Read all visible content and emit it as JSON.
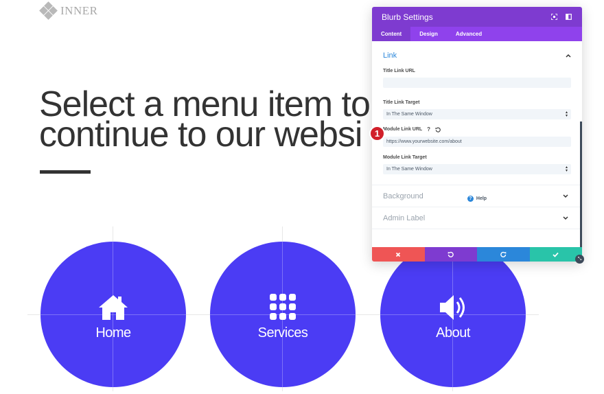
{
  "page": {
    "logo_text": "INNER",
    "hero_line_1": "Select a menu item to",
    "hero_line_2": "continue to our websi",
    "blurbs": [
      {
        "label": "Home",
        "icon": "home-icon"
      },
      {
        "label": "Services",
        "icon": "grid-icon"
      },
      {
        "label": "About",
        "icon": "speaker-icon"
      }
    ]
  },
  "panel": {
    "title": "Blurb Settings",
    "tabs": [
      "Content",
      "Design",
      "Advanced"
    ],
    "active_tab": "Content",
    "link_section": {
      "title": "Link",
      "title_link_url_label": "Title Link URL",
      "title_link_url_value": "",
      "title_link_target_label": "Title Link Target",
      "title_link_target_value": "In The Same Window",
      "module_link_url_label": "Module Link URL",
      "module_link_url_value": "https://www.yourwebsite.com/about",
      "module_link_target_label": "Module Link Target",
      "module_link_target_value": "In The Same Window"
    },
    "closed_sections": [
      "Background",
      "Admin Label"
    ],
    "help_label": "Help",
    "badge_number": "1"
  },
  "colors": {
    "accent_purple": "#7e3bd0",
    "tab_bar": "#8f42ec",
    "blurb_blue": "#4b3cf4",
    "cancel_red": "#ef5555",
    "undo_purple": "#7e3bd0",
    "redo_blue": "#2b87da",
    "save_green": "#29c4a9"
  }
}
